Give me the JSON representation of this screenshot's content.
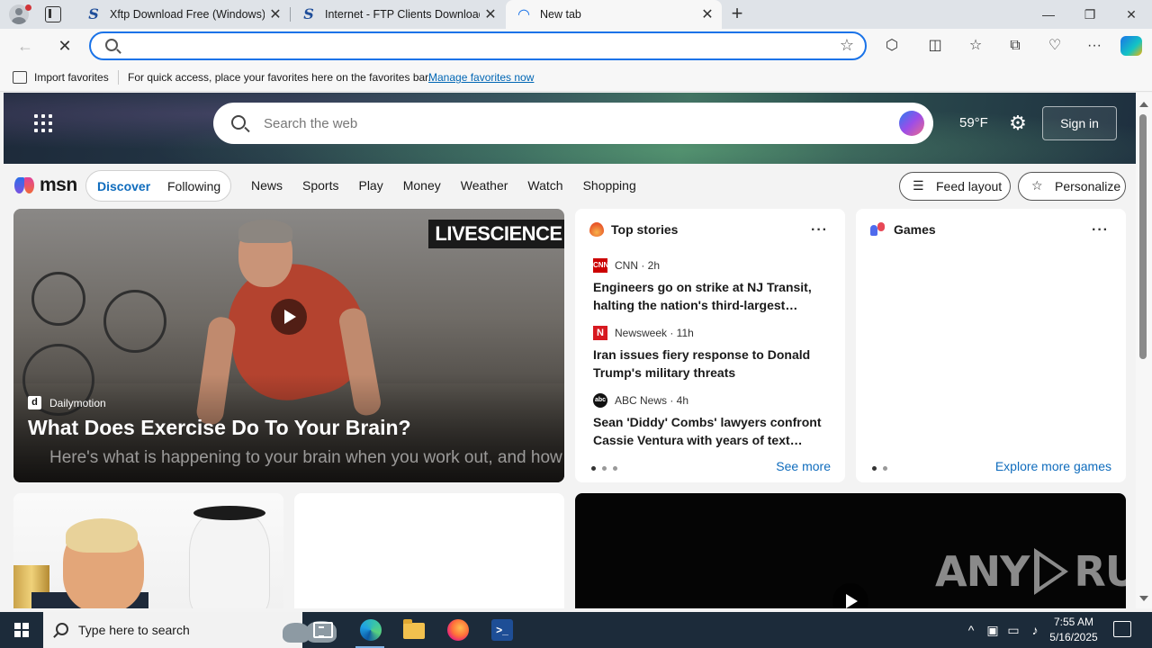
{
  "browser": {
    "tabs": [
      {
        "title": "Xftp Download Free (Windows) - ",
        "favicon": "S",
        "close": "✕"
      },
      {
        "title": "Internet - FTP Clients Downloads",
        "favicon": "S",
        "close": "✕"
      },
      {
        "title": "New tab",
        "close": "✕"
      }
    ],
    "address_value": "",
    "favorites_bar": {
      "import_label": "Import favorites",
      "message": "For quick access, place your favorites here on the favorites bar.",
      "manage_link": "Manage favorites now"
    },
    "colors": {
      "accent": "#1a73e8",
      "tabbar": "#dfe3e8",
      "link": "#0066b4"
    }
  },
  "msn": {
    "search_placeholder": "Search the web",
    "weather": "59°F",
    "sign_in": "Sign in",
    "logo_text": "msn",
    "pills": [
      "Discover",
      "Following"
    ],
    "nav": [
      "News",
      "Sports",
      "Play",
      "Money",
      "Weather",
      "Watch",
      "Shopping"
    ],
    "feed_layout": "Feed layout",
    "personalize": "Personalize",
    "hero": {
      "brand": "LIVESCIENCE",
      "source_initial": "d",
      "source": "Dailymotion",
      "title": "What Does Exercise Do To Your Brain?",
      "subtitle": "Here's what is happening to your brain when you work out, and how it can benefit you"
    },
    "top_stories": {
      "heading": "Top stories",
      "more": "···",
      "items": [
        {
          "source": "CNN · 2h",
          "logo": "CNN",
          "logo_color": "#cc0000",
          "headline": "Engineers go on strike at NJ Transit, halting the nation's third-largest…"
        },
        {
          "source": "Newsweek · 11h",
          "logo": "N",
          "logo_color": "#d71920",
          "headline": "Iran issues fiery response to Donald Trump's military threats"
        },
        {
          "source": "ABC News · 4h",
          "logo": "abc",
          "logo_color": "#111111",
          "headline": "Sean 'Diddy' Combs' lawyers confront Cassie Ventura with years of text…"
        }
      ],
      "see_more": "See more"
    },
    "games": {
      "heading": "Games",
      "more": "···",
      "explore": "Explore more games"
    },
    "watermark": "ANY RUN"
  },
  "taskbar": {
    "search_text": "Type here to search",
    "time": "7:55 AM",
    "date": "5/16/2025"
  }
}
